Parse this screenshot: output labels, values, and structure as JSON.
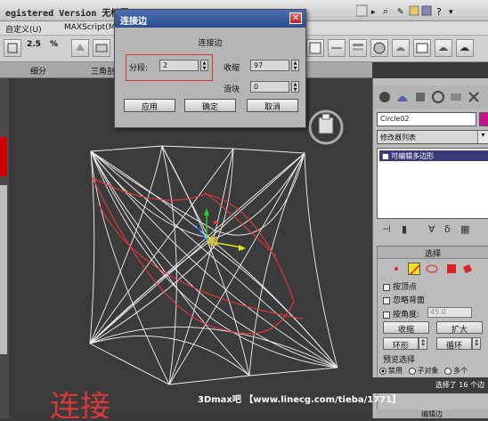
{
  "app": {
    "title": "egistered Version  无标题"
  },
  "menu": {
    "customize": "自定义(U)",
    "maxscript": "MAXScript(M)"
  },
  "toolbar": {
    "snap_value": "2.5",
    "percent_value": "%"
  },
  "ribbon": {
    "tab1": "细分",
    "tab2": "三角剖"
  },
  "dialog": {
    "title": "连接边",
    "group": "连接边",
    "segments_label": "分段:",
    "segments_value": "2",
    "pinch_label": "收缩",
    "pinch_value": "97",
    "slide_label": "滑块",
    "slide_value": "0",
    "apply": "应用",
    "ok": "确定",
    "cancel": "取消",
    "close": "✕"
  },
  "command_panel": {
    "object_name": "Circle02",
    "modifier_list": "修改器列表",
    "stack_item": "可编辑多边形",
    "selection_title": "选择",
    "by_vertex": "按顶点",
    "ignore_backfacing": "忽略背面",
    "by_angle": "按角度:",
    "angle_value": "45.0",
    "shrink": "收缩",
    "grow": "扩大",
    "ring": "环形",
    "loop": "循环",
    "preview_label": "预览选择",
    "preview_off": "禁用",
    "preview_subobj": "子对象",
    "preview_multi": "多个",
    "status": "选择了 16 个边",
    "edit_edges": "编辑边"
  },
  "watermark": "3Dmax吧 【www.linecg.com/tieba/1771】",
  "handwriting": "连接",
  "colors": {
    "accent": "#c8108a",
    "title_bar": "#2a4d8f",
    "highlight": "#e03333"
  }
}
